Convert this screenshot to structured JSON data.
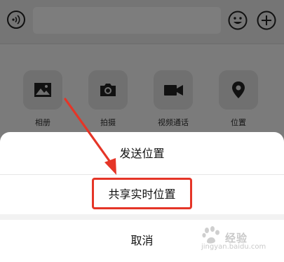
{
  "toolbar_panel": {
    "items": [
      {
        "label": "相册",
        "icon": "image-icon"
      },
      {
        "label": "拍摄",
        "icon": "camera-icon"
      },
      {
        "label": "视频通话",
        "icon": "video-call-icon"
      },
      {
        "label": "位置",
        "icon": "location-pin-icon"
      }
    ]
  },
  "action_sheet": {
    "send_location": "发送位置",
    "share_live_location": "共享实时位置",
    "cancel": "取消"
  },
  "annotation": {
    "highlight_color": "#e53527"
  },
  "watermark": {
    "brand": "经验",
    "url": "jingyan.baidu.com"
  },
  "colors": {
    "overlay_dim": "#7b7b7b",
    "sheet_bg": "#ffffff"
  }
}
